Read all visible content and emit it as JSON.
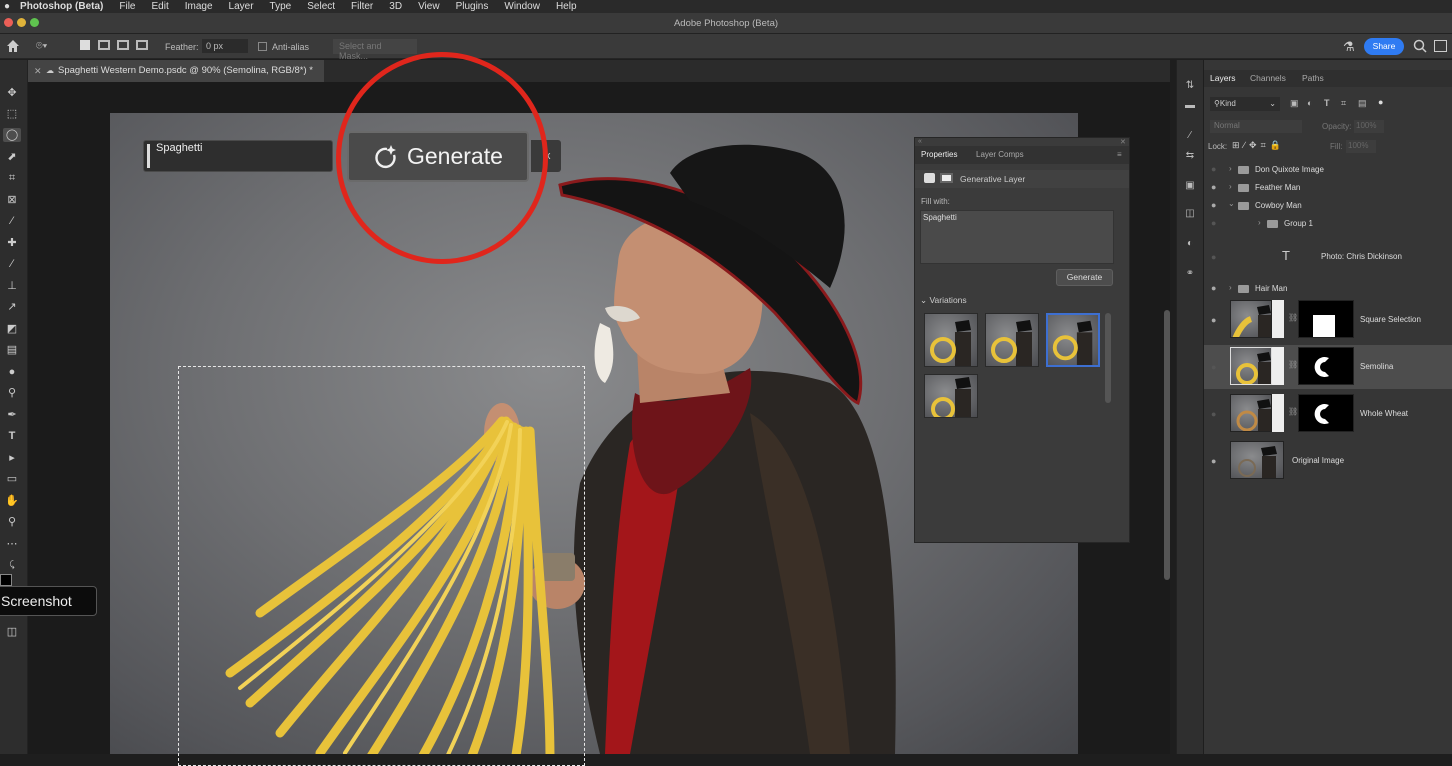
{
  "menubar": {
    "app": "Photoshop (Beta)",
    "items": [
      "File",
      "Edit",
      "Image",
      "Layer",
      "Type",
      "Select",
      "Filter",
      "3D",
      "View",
      "Plugins",
      "Window",
      "Help"
    ]
  },
  "window_title": "Adobe Photoshop (Beta)",
  "options": {
    "feather_label": "Feather:",
    "feather_value": "0 px",
    "antialias_label": "Anti-alias",
    "select_mask": "Select and Mask...",
    "share_label": "Share"
  },
  "document_tab": "Spaghetti Western Demo.psdc @ 90% (Semolina, RGB/8*) *",
  "contextual": {
    "prompt_value": "Spaghetti",
    "generate_label": "Generate",
    "close_label": "x"
  },
  "properties": {
    "tabs": [
      "Properties",
      "Layer Comps"
    ],
    "layer_type": "Generative Layer",
    "fill_with_label": "Fill with:",
    "fill_text": "Spaghetti",
    "generate_button": "Generate",
    "variations_label": "Variations"
  },
  "layers_panel": {
    "tabs": [
      "Layers",
      "Channels",
      "Paths"
    ],
    "filter_label": "Kind",
    "blend_mode": "Normal",
    "opacity_label": "Opacity:",
    "opacity_value": "100%",
    "lock_label": "Lock:",
    "fill_label": "Fill:",
    "fill_value": "100%",
    "rows": [
      {
        "name": "Don Quixote Image",
        "kind": "group"
      },
      {
        "name": "Feather Man",
        "kind": "group"
      },
      {
        "name": "Cowboy Man",
        "kind": "group-open"
      },
      {
        "name": "Group 1",
        "kind": "group"
      },
      {
        "name": "Photo: Chris Dickinson",
        "kind": "text"
      },
      {
        "name": "Hair Man",
        "kind": "group"
      },
      {
        "name": "Square Selection",
        "kind": "generative"
      },
      {
        "name": "Semolina",
        "kind": "generative"
      },
      {
        "name": "Whole Wheat",
        "kind": "generative"
      },
      {
        "name": "Original Image",
        "kind": "image"
      }
    ]
  },
  "tooltip": "Screenshot",
  "colors": {
    "accent": "#3d6fd1",
    "highlight_circle": "#e0261c",
    "spaghetti": "#e8c23a"
  }
}
